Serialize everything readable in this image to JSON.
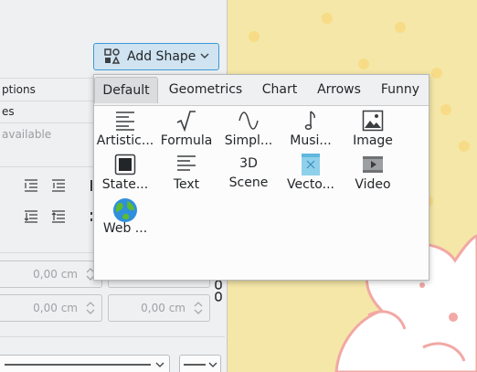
{
  "docker": {
    "add_shape_label": "Add Shape",
    "row_options": "ptions",
    "row_es": "es",
    "row_available": "available",
    "spin1_value": "0,00 cm",
    "spin2_value": "0,00 cm",
    "spin3_value": "0,00 cm"
  },
  "popup": {
    "tabs": [
      "Default",
      "Geometrics",
      "Chart",
      "Arrows",
      "Funny"
    ],
    "active_tab": "Default",
    "shapes": [
      {
        "label": "Artistic...",
        "icon": "artistic-text-icon"
      },
      {
        "label": "Formula",
        "icon": "formula-icon"
      },
      {
        "label": "Simpl...",
        "icon": "simple-function-icon"
      },
      {
        "label": "Musi...",
        "icon": "music-note-icon"
      },
      {
        "label": "Image",
        "icon": "image-icon"
      },
      {
        "label": "State...",
        "icon": "state-icon"
      },
      {
        "label": "Text",
        "icon": "text-icon"
      },
      {
        "label_line1": "3D",
        "label_line2": "Scene",
        "icon": "none"
      },
      {
        "label": "Vecto...",
        "icon": "vector-icon"
      },
      {
        "label": "Video",
        "icon": "video-icon"
      },
      {
        "label": "Web ...",
        "icon": "globe-icon"
      }
    ]
  },
  "colors": {
    "canvas_bg": "#f5e7a7",
    "accent": "#3d9ad8",
    "panel_bg": "#eff0f1"
  }
}
